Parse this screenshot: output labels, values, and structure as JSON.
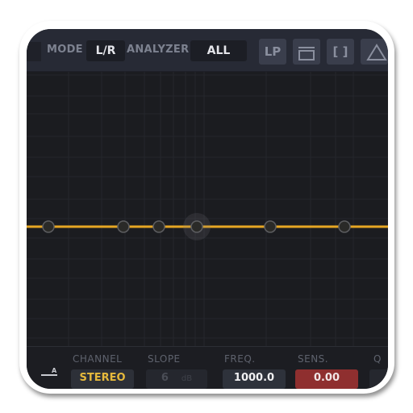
{
  "header": {
    "mode_label": "MODE",
    "mode_value": "L/R",
    "analyzer_label": "ANALYZER",
    "analyzer_value": "ALL",
    "buttons": [
      {
        "label": "LP",
        "icon": "lp-text"
      },
      {
        "label": "",
        "icon": "window-icon"
      },
      {
        "label": "[ ]",
        "icon": "bracket-icon"
      },
      {
        "label": "",
        "icon": "triangle-icon"
      }
    ]
  },
  "graph": {
    "curve_color": "#e6a623",
    "band_nodes": 6,
    "selected_node": 4
  },
  "footer": {
    "ab_label": "A",
    "channel_label": "CHANNEL",
    "channel_value": "STEREO",
    "slope_label": "SLOPE",
    "slope_value": "6",
    "slope_unit": "dB",
    "freq_label": "FREQ.",
    "freq_value": "1000.0",
    "sens_label": "SENS.",
    "sens_value": "0.00",
    "q_label": "Q"
  },
  "colors": {
    "accent_yellow": "#e6b93c",
    "sens_red": "#8f2f2f",
    "panel": "#272a35",
    "graph_bg": "#1b1c20"
  }
}
